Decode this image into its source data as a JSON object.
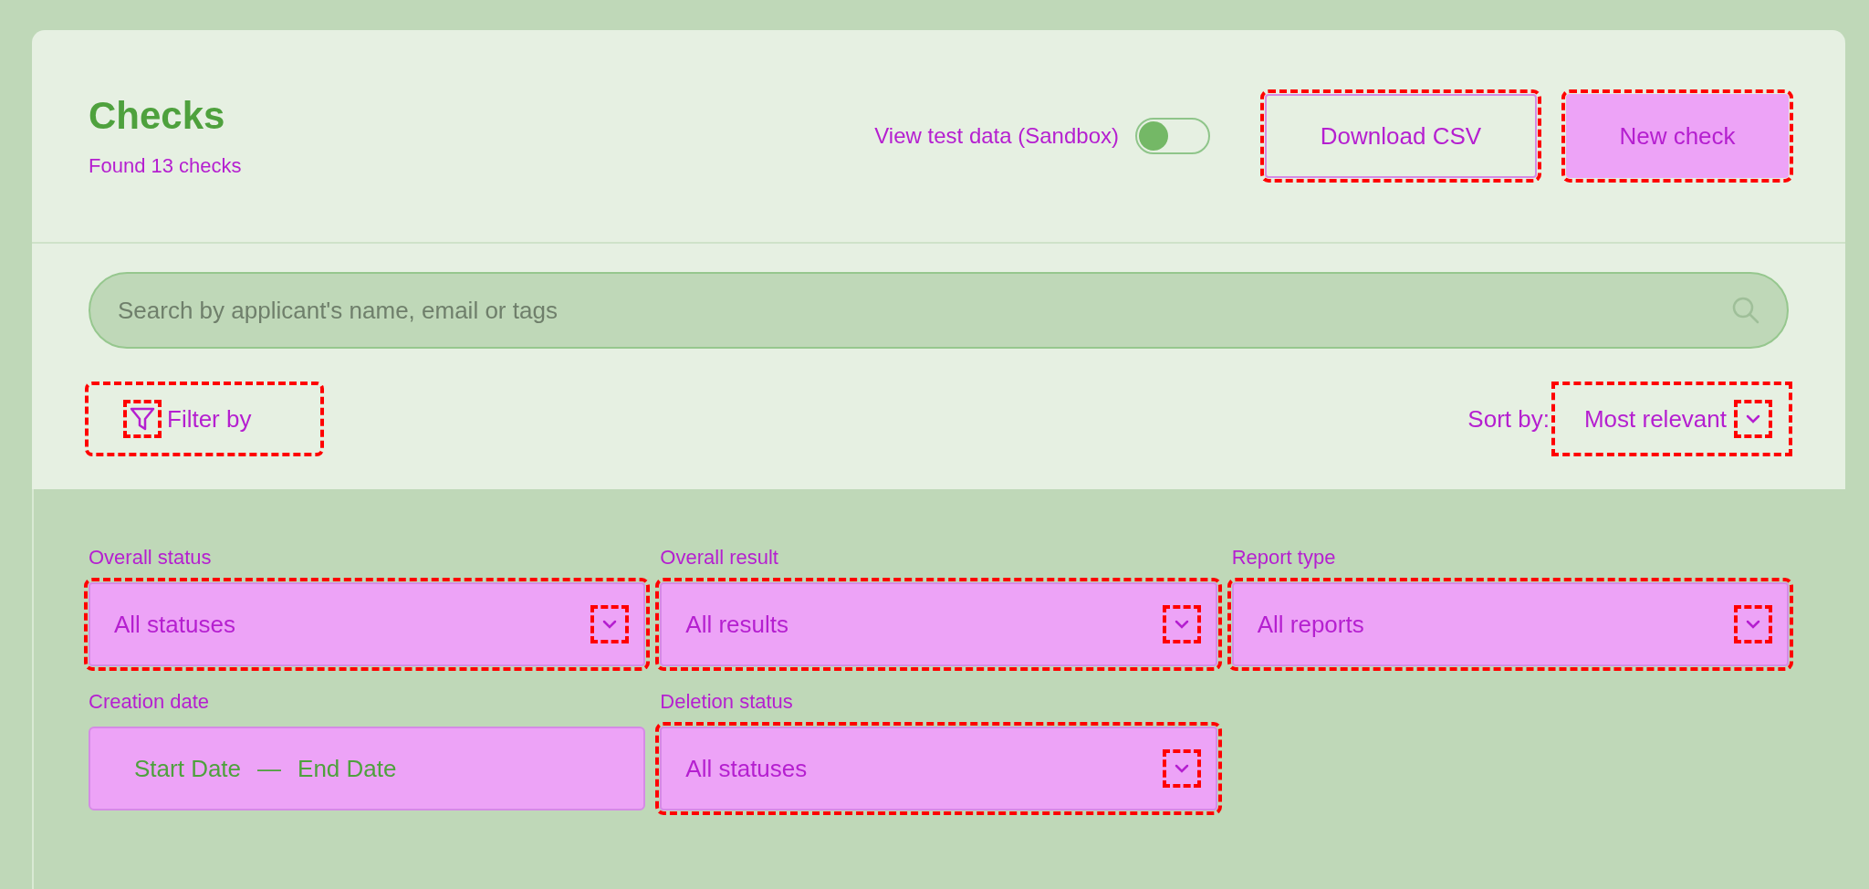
{
  "header": {
    "title": "Checks",
    "subtitle": "Found 13 checks"
  },
  "sandbox_toggle": {
    "label": "View test data (Sandbox)",
    "on": false
  },
  "buttons": [
    {
      "label": "Download CSV",
      "kind": "outline"
    },
    {
      "label": "New check",
      "kind": "filled"
    }
  ],
  "search": {
    "placeholder": "Search by applicant's name, email or tags"
  },
  "filter_button": {
    "label": "Filter by"
  },
  "sort": {
    "label": "Sort by:",
    "value": "Most relevant"
  },
  "filters": [
    {
      "label": "Overall status",
      "value": "All statuses",
      "kind": "select"
    },
    {
      "label": "Overall result",
      "value": "All results",
      "kind": "select"
    },
    {
      "label": "Report type",
      "value": "All reports",
      "kind": "select"
    },
    {
      "label": "Creation date",
      "kind": "daterange",
      "start": "Start Date",
      "separator": "—",
      "end": "End Date"
    },
    {
      "label": "Deletion status",
      "value": "All statuses",
      "kind": "select"
    }
  ]
}
